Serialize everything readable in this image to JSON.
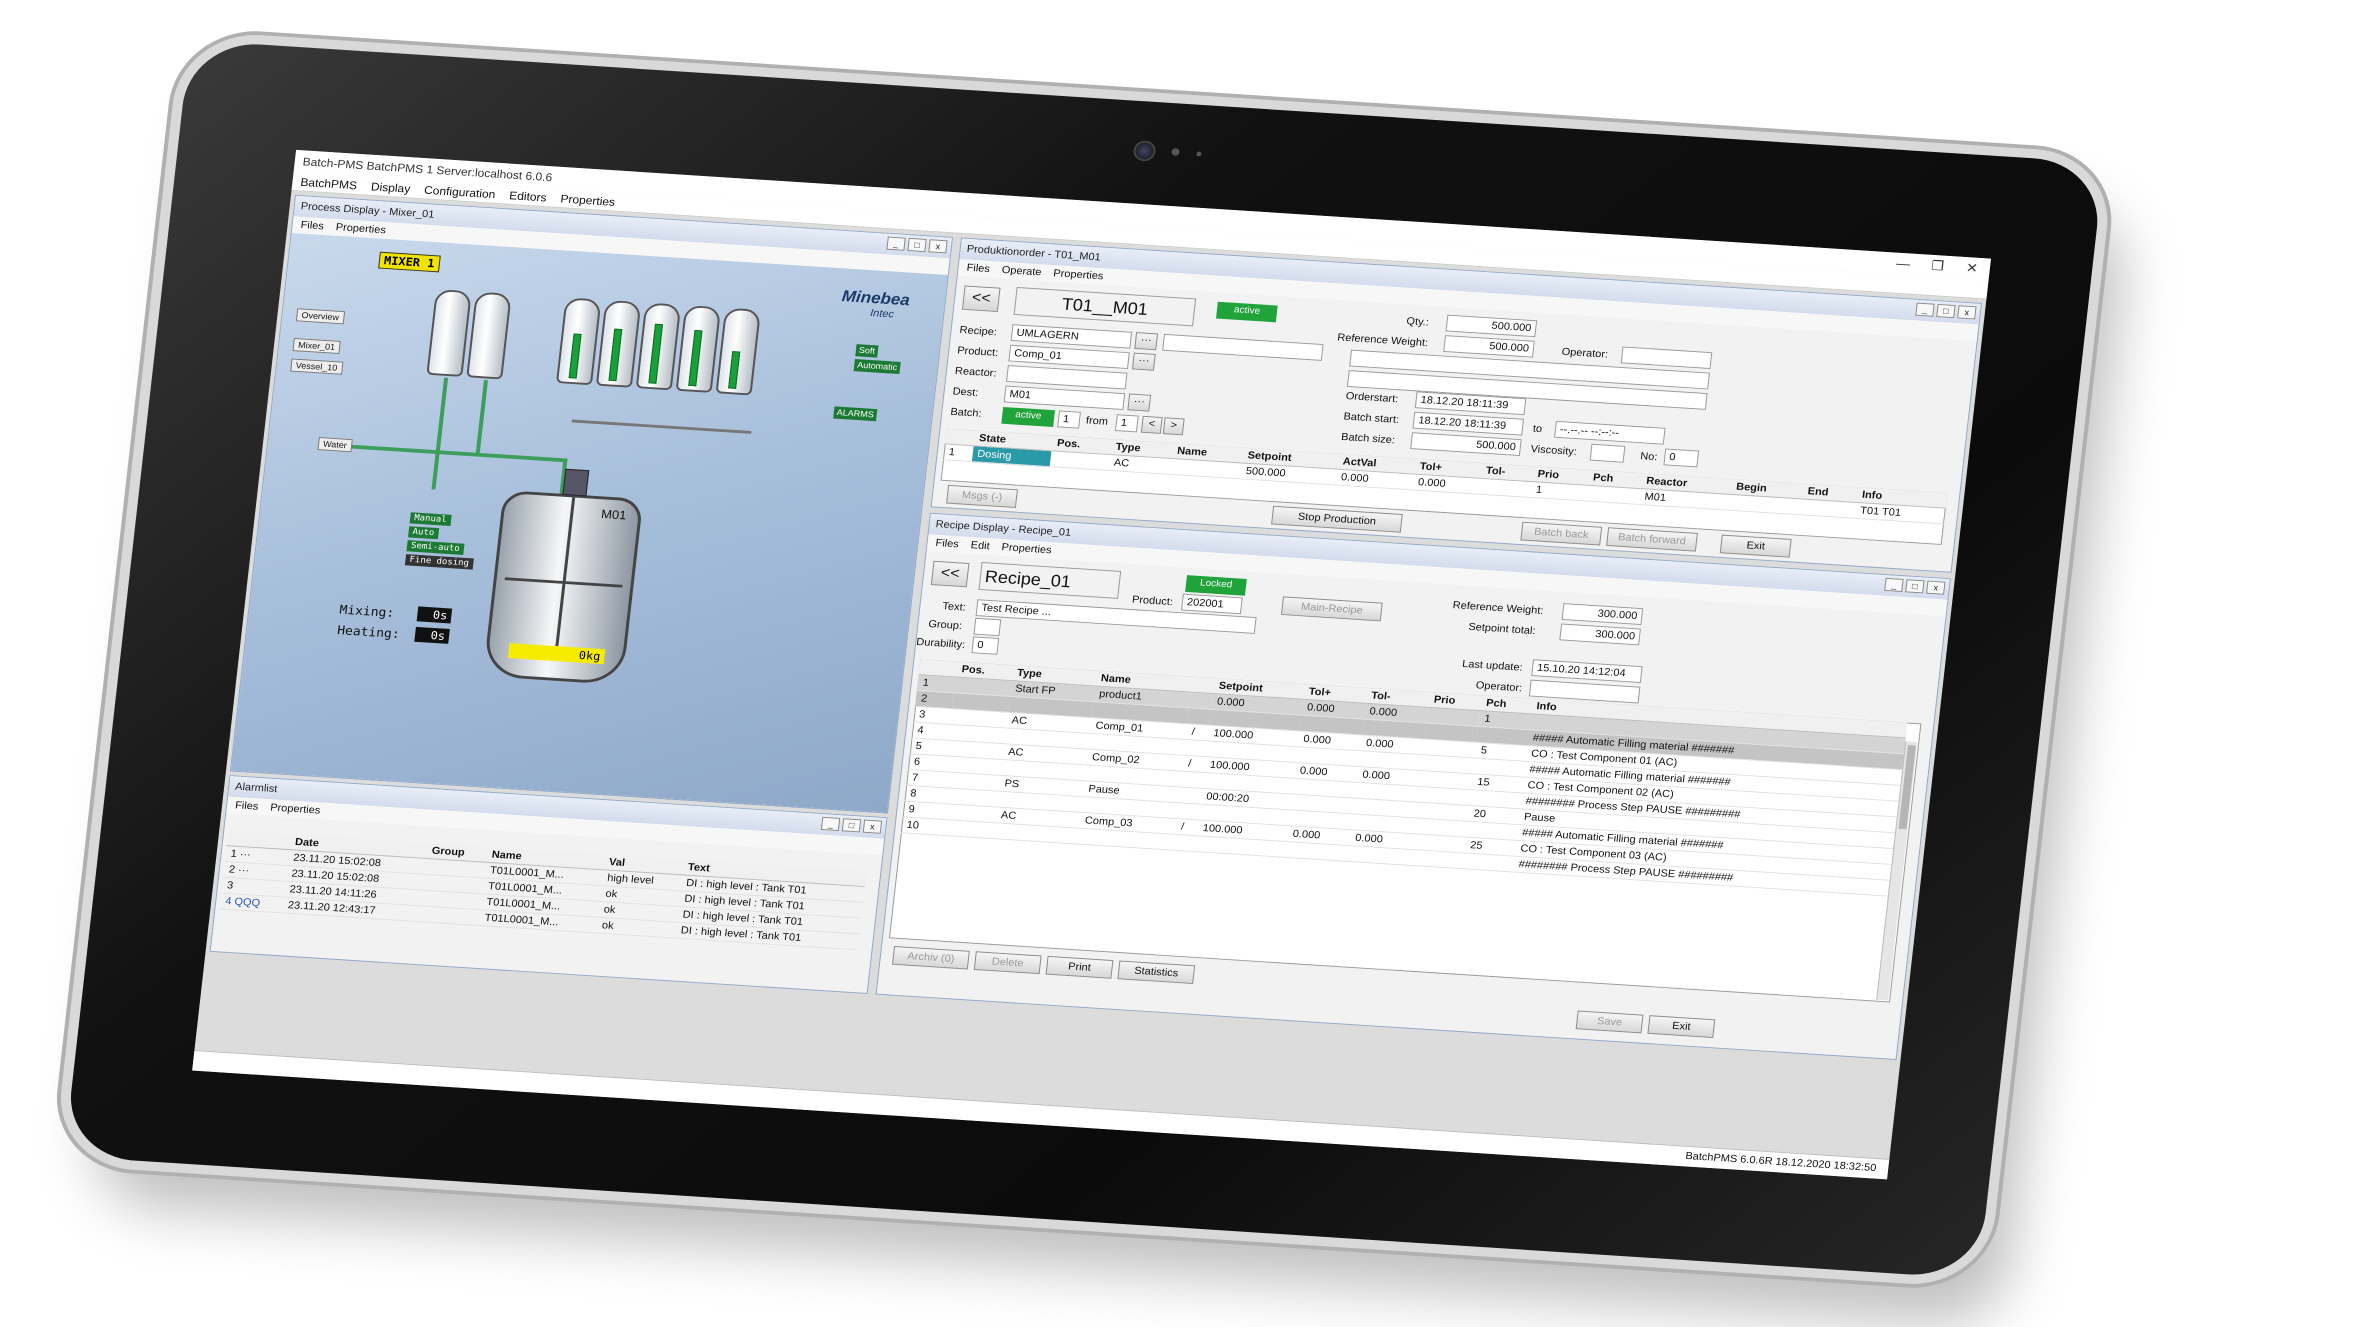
{
  "app": {
    "title": "Batch-PMS BatchPMS 1 Server:localhost 6.0.6",
    "menu": [
      "BatchPMS",
      "Display",
      "Configuration",
      "Editors",
      "Properties"
    ],
    "statusbar": "BatchPMS    6.0.6R  18.12.2020 18:32:50"
  },
  "process_display": {
    "title": "Process Display - Mixer_01",
    "menu": [
      "Files",
      "Properties"
    ],
    "mixer_label": "MIXER 1",
    "logo": "Minebea",
    "logo_sub": "Intec",
    "nav_buttons": [
      "Overview",
      "Mixer_01",
      "Vessel_10"
    ],
    "side_tags": [
      "Soft",
      "Automatic"
    ],
    "alarm_tag": "ALARMS",
    "water_label": "Water",
    "hmi_labels": [
      "Manual",
      "Auto",
      "Semi-auto",
      "Fine dosing"
    ],
    "reactor_name": "M01",
    "mixing_label": "Mixing:",
    "mixing_value": "0s",
    "heating_label": "Heating:",
    "heating_value": "0s",
    "weight_value": "0kg",
    "tank_fill_levels": [
      0,
      0,
      0.6,
      0.7,
      0.8,
      0.75,
      0.5
    ]
  },
  "alarmlist": {
    "title": "Alarmlist",
    "menu": [
      "Files",
      "Properties"
    ],
    "columns": [
      "",
      "Date",
      "Group",
      "Name",
      "Val",
      "Text"
    ],
    "rows": [
      [
        "1 ···",
        "23.11.20 15:02:08",
        "",
        "T01L0001_M...",
        "high level",
        "DI : high level : Tank T01"
      ],
      [
        "2 ···",
        "23.11.20 15:02:08",
        "",
        "T01L0001_M...",
        "ok",
        "DI : high level : Tank T01"
      ],
      [
        "3",
        "23.11.20 14:11:26",
        "",
        "T01L0001_M...",
        "ok",
        "DI : high level : Tank T01"
      ],
      [
        "4 QQQ",
        "23.11.20 12:43:17",
        "",
        "T01L0001_M...",
        "ok",
        "DI : high level : Tank T01"
      ]
    ]
  },
  "production_order": {
    "title": "Produktionorder - T01_M01",
    "menu": [
      "Files",
      "Operate",
      "Properties"
    ],
    "back_label": "<<",
    "order_name": "T01__M01",
    "status": "active",
    "qty_label": "Qty.:",
    "qty_value": "500.000",
    "refweight_label": "Reference Weight:",
    "refweight_value": "500.000",
    "operator_label": "Operator:",
    "recipe_label": "Recipe:",
    "recipe_value": "UMLAGERN",
    "product_label": "Product:",
    "product_value": "Comp_01",
    "reactor_label": "Reactor:",
    "dest_label": "Dest:",
    "dest_value": "M01",
    "batch_label": "Batch:",
    "batch_state": "active",
    "batch_no": "1",
    "from_label": "from",
    "batch_total": "1",
    "orderstart_label": "Orderstart:",
    "orderstart_value": "18.12.20 18:11:39",
    "batchstart_label": "Batch start:",
    "batchstart_value": "18.12.20 18:11:39",
    "to_label": "to",
    "to_value": "--.--.-- --:--:--",
    "batchsize_label": "Batch size:",
    "batchsize_value": "500.000",
    "viscosity_label": "Viscosity:",
    "no_label": "No:",
    "no_value": "0",
    "columns": [
      "",
      "State",
      "Pos.",
      "Type",
      "Name",
      "Setpoint",
      "ActVal",
      "Tol+",
      "Tol-",
      "Prio",
      "Pch",
      "Reactor",
      "Begin",
      "End",
      "Info"
    ],
    "rows": [
      [
        "1",
        "Dosing",
        "",
        "AC",
        "",
        "500.000",
        "0.000",
        "0.000",
        "",
        "1",
        "",
        "M01",
        "",
        "",
        "T01 T01"
      ]
    ],
    "buttons": {
      "msgs": "Msgs (-)",
      "stop": "Stop Production",
      "batch_back": "Batch back",
      "batch_forward": "Batch forward",
      "exit": "Exit"
    }
  },
  "recipe_display": {
    "title": "Recipe Display - Recipe_01",
    "menu": [
      "Files",
      "Edit",
      "Properties"
    ],
    "back_label": "<<",
    "recipe_name": "Recipe_01",
    "status": "Locked",
    "product_label": "Product:",
    "product_value": "202001",
    "main_recipe": "Main-Recipe",
    "refweight_label": "Reference Weight:",
    "refweight_value": "300.000",
    "setpoint_label": "Setpoint total:",
    "setpoint_value": "300.000",
    "text_label": "Text:",
    "text_value": "Test Recipe ...",
    "group_label": "Group:",
    "durability_label": "Durability:",
    "durability_value": "0",
    "lastupdate_label": "Last update:",
    "lastupdate_value": "15.10.20 14:12:04",
    "operator_label": "Operator:",
    "columns": [
      "",
      "Pos.",
      "Type",
      "Name",
      "",
      "Setpoint",
      "Tol+",
      "Tol-",
      "Prio",
      "Pch",
      "Info"
    ],
    "rows": [
      [
        "1",
        "",
        "Start FP",
        "product1",
        "",
        "0.000",
        "0.000",
        "0.000",
        "",
        "1",
        ""
      ],
      [
        "2",
        "",
        "",
        "",
        "",
        "",
        "",
        "",
        "",
        "",
        "##### Automatic Filling material #######"
      ],
      [
        "3",
        "",
        "AC",
        "Comp_01",
        "/",
        "100.000",
        "0.000",
        "0.000",
        "",
        "5",
        "CO : Test Component 01 (AC)"
      ],
      [
        "4",
        "",
        "",
        "",
        "",
        "",
        "",
        "",
        "",
        "",
        "##### Automatic Filling material #######"
      ],
      [
        "5",
        "",
        "AC",
        "Comp_02",
        "/",
        "100.000",
        "0.000",
        "0.000",
        "",
        "15",
        "CO : Test Component 02 (AC)"
      ],
      [
        "6",
        "",
        "",
        "",
        "",
        "",
        "",
        "",
        "",
        "",
        "######## Process Step PAUSE #########"
      ],
      [
        "7",
        "",
        "PS",
        "Pause",
        "",
        "00:00:20",
        "",
        "",
        "",
        "20",
        "Pause"
      ],
      [
        "8",
        "",
        "",
        "",
        "",
        "",
        "",
        "",
        "",
        "",
        "##### Automatic Filling material #######"
      ],
      [
        "9",
        "",
        "AC",
        "Comp_03",
        "/",
        "100.000",
        "0.000",
        "0.000",
        "",
        "25",
        "CO : Test Component 03 (AC)"
      ],
      [
        "10",
        "",
        "",
        "",
        "",
        "",
        "",
        "",
        "",
        "",
        "######## Process Step PAUSE #########"
      ]
    ],
    "buttons": {
      "archive": "Archiv (0)",
      "delete": "Delete",
      "print": "Print",
      "statistics": "Statistics",
      "save": "Save",
      "exit": "Exit"
    }
  }
}
